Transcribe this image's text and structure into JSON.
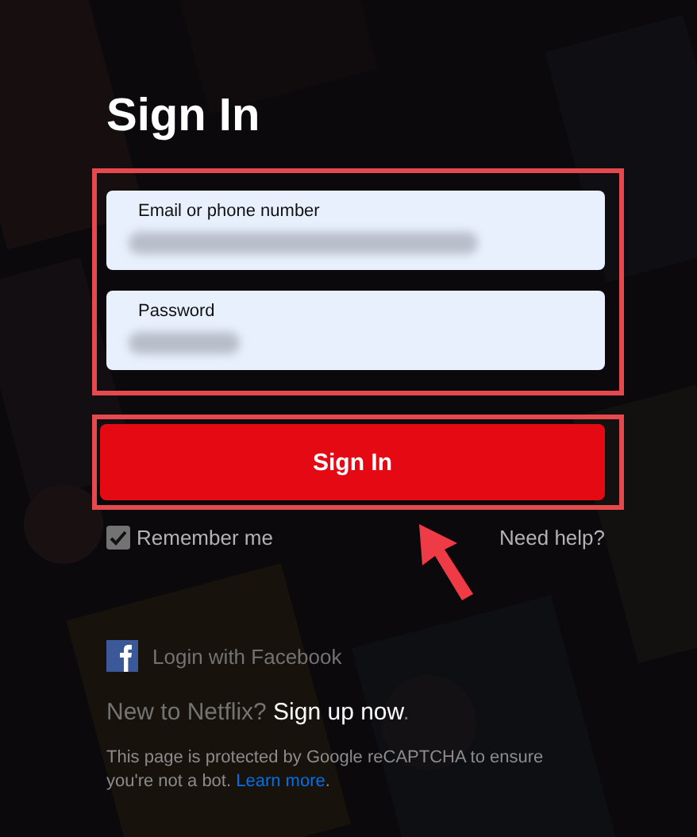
{
  "title": "Sign In",
  "fields": [
    {
      "label": "Email or phone number",
      "obscured": true
    },
    {
      "label": "Password",
      "obscured": true
    }
  ],
  "sign_in_button": "Sign In",
  "remember_me": {
    "label": "Remember me",
    "checked": true
  },
  "need_help": "Need help?",
  "facebook_login": "Login with Facebook",
  "signup": {
    "question": "New to Netflix?",
    "link": "Sign up now",
    "end": "."
  },
  "recaptcha": {
    "text": "This page is protected by Google reCAPTCHA to ensure you're not a bot.",
    "link": "Learn more",
    "end": "."
  },
  "annotations": {
    "highlight_fields": true,
    "highlight_button": true,
    "arrow": true
  }
}
